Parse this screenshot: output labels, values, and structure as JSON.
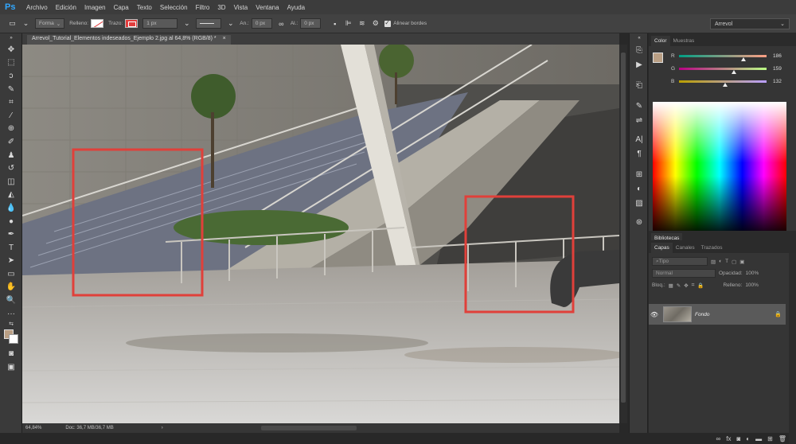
{
  "app": {
    "logo": "Ps"
  },
  "menu": [
    "Archivo",
    "Edición",
    "Imagen",
    "Capa",
    "Texto",
    "Selección",
    "Filtro",
    "3D",
    "Vista",
    "Ventana",
    "Ayuda"
  ],
  "options": {
    "shape_mode": "Forma",
    "fill_label": "Relleno:",
    "stroke_label": "Trazo:",
    "stroke_width": "1 px",
    "w_label": "An.:",
    "w_value": "0 px",
    "h_label": "Al.:",
    "h_value": "0 px",
    "align_edges": "Alinear bordes",
    "workspace": "Arrevol"
  },
  "document": {
    "tab_title": "Arrevol_Tutorial_Elementos indeseados_Ejemplo 2.jpg al 64,8% (RGB/8) *",
    "close": "×"
  },
  "status": {
    "zoom": "64,84%",
    "doc": "Doc: 36,7 MB/36,7 MB"
  },
  "color_panel": {
    "tabs": [
      "Color",
      "Muestras"
    ],
    "fg_color": "#ba9f84",
    "bg_color": "#ffffff",
    "r": {
      "label": "R",
      "value": "186"
    },
    "g": {
      "label": "G",
      "value": "159"
    },
    "b": {
      "label": "B",
      "value": "132"
    }
  },
  "libraries_panel": {
    "tab": "Bibliotecas"
  },
  "layers_panel": {
    "tabs": [
      "Capas",
      "Canales",
      "Trazados"
    ],
    "search": "Tipo",
    "blend_mode": "Normal",
    "opacity_label": "Opacidad:",
    "opacity_value": "100%",
    "lock_label": "Bloq.:",
    "fill_label": "Relleno:",
    "fill_value": "100%",
    "layers": [
      {
        "name": "Fondo",
        "locked": true,
        "visible": true
      }
    ]
  },
  "annotations": {
    "box_color": "#e0403a"
  }
}
